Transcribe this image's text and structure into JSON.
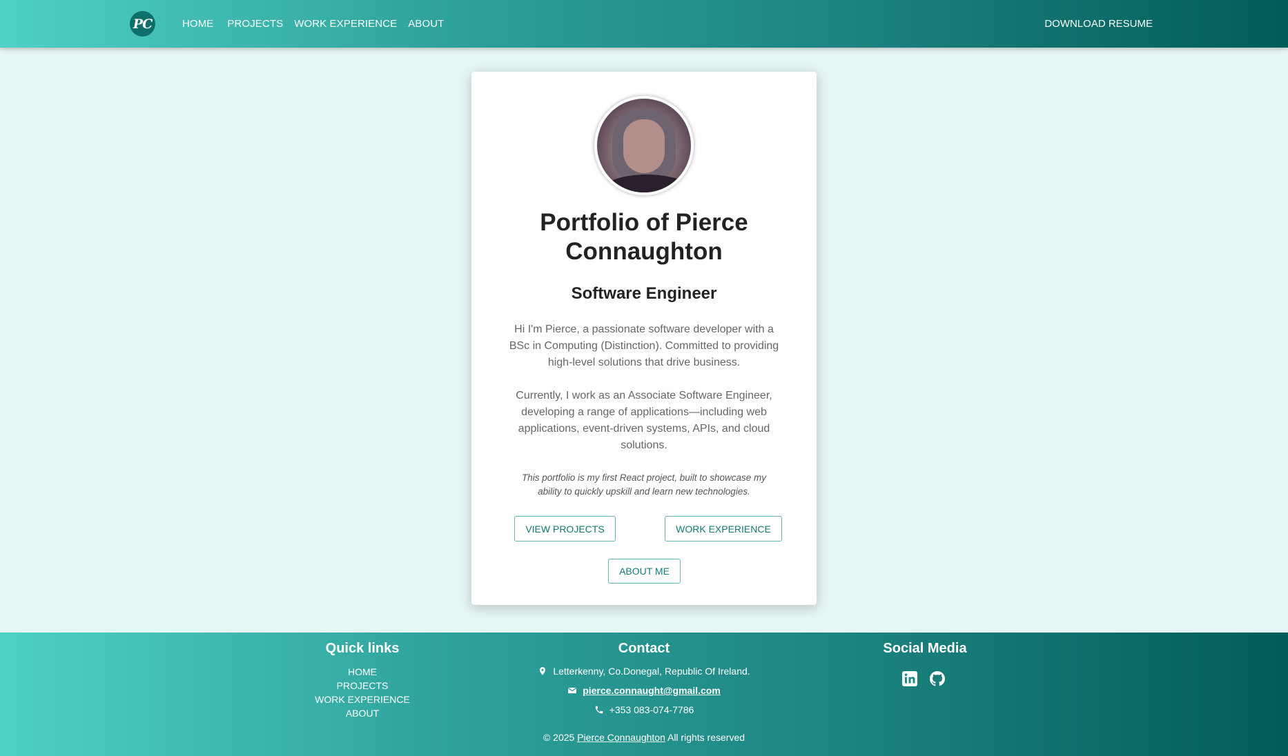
{
  "nav": {
    "logo_text": "PC",
    "links": [
      "HOME",
      "PROJECTS",
      "WORK EXPERIENCE",
      "ABOUT"
    ],
    "download_label": "DOWNLOAD RESUME"
  },
  "hero": {
    "title": "Portfolio of Pierce Connaughton",
    "subtitle": "Software Engineer",
    "paragraph1": "Hi I'm Pierce, a passionate software developer with a BSc in Computing (Distinction). Committed to providing high-level solutions that drive business.",
    "paragraph2": "Currently, I work as an Associate Software Engineer, developing a range of applications—including web applications, event-driven systems, APIs, and cloud solutions.",
    "note": "This portfolio is my first React project, built to showcase my ability to quickly upskill and learn new technologies.",
    "buttons": {
      "projects": "VIEW PROJECTS",
      "experience": "WORK EXPERIENCE",
      "about": "ABOUT ME"
    }
  },
  "footer": {
    "quick_links_title": "Quick links",
    "quick_links": [
      "HOME",
      "PROJECTS",
      "WORK EXPERIENCE",
      "ABOUT"
    ],
    "contact_title": "Contact",
    "address": "Letterkenny, Co.Donegal, Republic Of Ireland.",
    "email": "pierce.connaught@gmail.com",
    "phone": "+353 083-074-7786",
    "social_title": "Social Media",
    "social_icons": [
      "linkedin-icon",
      "github-icon"
    ],
    "copyright_prefix": "© 2025",
    "copyright_name": "Pierce Connaughton",
    "copyright_suffix": "All rights reserved"
  },
  "colors": {
    "teal_light": "#4fd1c5",
    "teal_dark": "#015c58",
    "page_bg": "#e6f6f5",
    "button_text": "#137a76"
  }
}
